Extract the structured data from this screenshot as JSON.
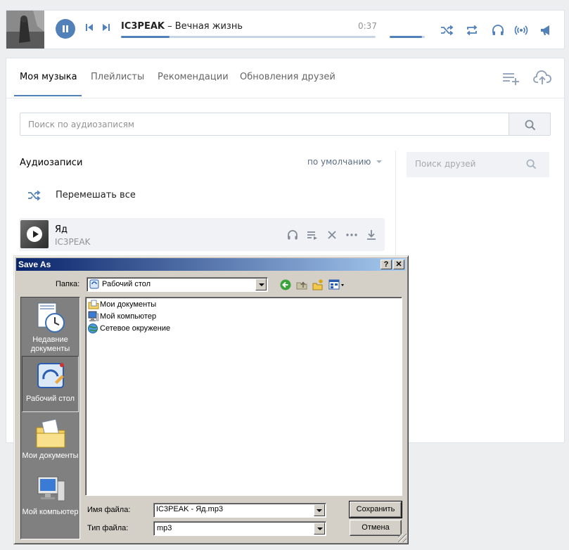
{
  "player": {
    "artist": "IC3PEAK",
    "separator": " – ",
    "title": "Вечная жизнь",
    "time": "0:37",
    "progress_fraction": 0.19,
    "volume_fraction": 0.92
  },
  "tabs": [
    {
      "label": "Моя музыка",
      "active": true
    },
    {
      "label": "Плейлисты"
    },
    {
      "label": "Рекомендации"
    },
    {
      "label": "Обновления друзей"
    }
  ],
  "search": {
    "placeholder": "Поиск по аудиозаписям"
  },
  "audios": {
    "section_title": "Аудиозаписи",
    "sort_label": "по умолчанию",
    "shuffle_label": "Перемешать все",
    "items": [
      {
        "title": "Яд",
        "artist": "IC3PEAK"
      }
    ]
  },
  "friends": {
    "search_placeholder": "Поиск друзей"
  },
  "dialog": {
    "title": "Save As",
    "help_btn": "?",
    "close_btn": "✕",
    "folder_label": "Папка:",
    "folder_value": "Рабочий стол",
    "places": [
      {
        "label": "Недавние документы",
        "icon": "recent-documents-icon"
      },
      {
        "label": "Рабочий стол",
        "icon": "desktop-icon",
        "selected": true
      },
      {
        "label": "Мои документы",
        "icon": "my-documents-icon"
      },
      {
        "label": "Мой компьютер",
        "icon": "my-computer-icon"
      }
    ],
    "files": [
      {
        "name": "Мои документы",
        "icon": "my-documents-icon"
      },
      {
        "name": "Мой компьютер",
        "icon": "my-computer-icon"
      },
      {
        "name": "Сетевое окружение",
        "icon": "network-icon"
      }
    ],
    "filename_label": "Имя файла:",
    "filename_value": "IC3PEAK - Яд.mp3",
    "filetype_label": "Тип файла:",
    "filetype_value": "mp3",
    "save_btn": "Сохранить",
    "cancel_btn": "Отмена"
  },
  "colors": {
    "accent": "#5181b8",
    "win_title": "#0a246a",
    "win_face": "#d4d0c8"
  }
}
